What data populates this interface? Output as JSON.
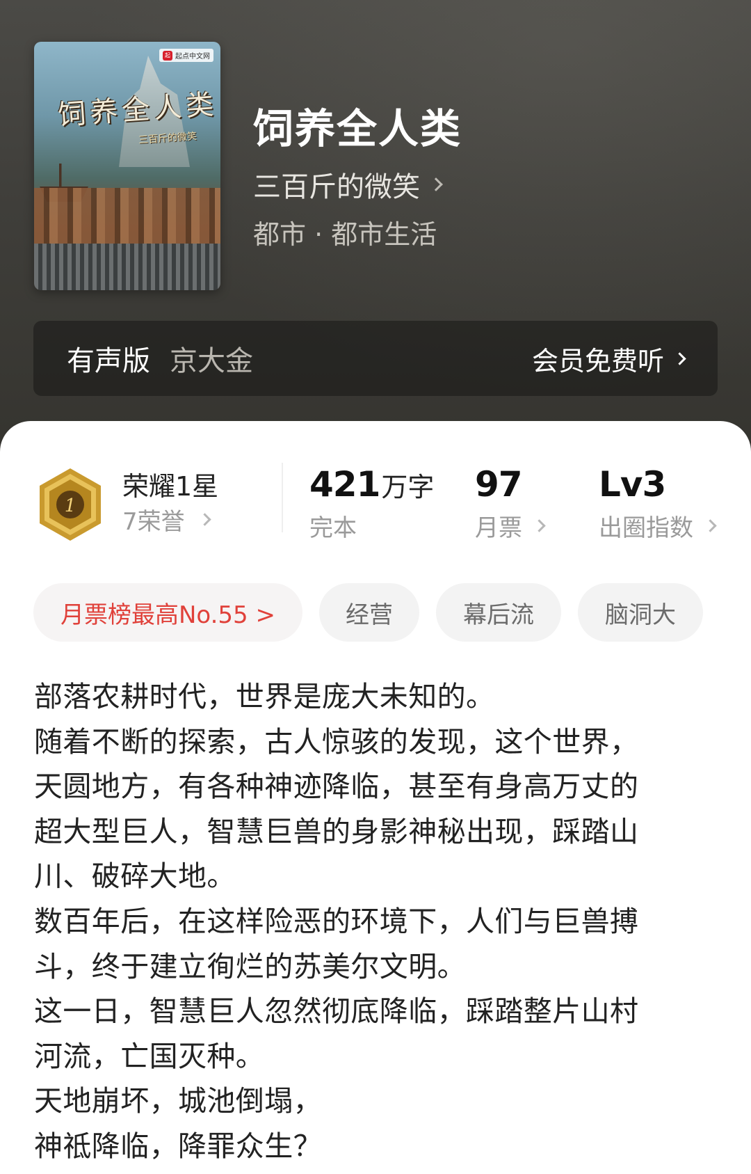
{
  "book": {
    "title": "饲养全人类",
    "author": "三百斤的微笑",
    "genre": "都市 · 都市生活"
  },
  "cover": {
    "title_art": "饲养全人类",
    "subtitle_art": "三百斤的微笑",
    "publisher_logo": "起点中文网"
  },
  "audio": {
    "label": "有声版",
    "narrator": "京大金",
    "action": "会员免费听"
  },
  "honor": {
    "title": "荣耀1星",
    "subtitle": "7荣誉",
    "badge_number": "1",
    "badge_icon": "gold-hexagon-medal-icon"
  },
  "stats": {
    "words_value": "421",
    "words_unit": "万字",
    "words_label": "完本",
    "votes_value": "97",
    "votes_label": "月票",
    "level_value": "Lv3",
    "level_label": "出圈指数"
  },
  "tags": {
    "rank": "月票榜最高No.55 >",
    "items": [
      "经营",
      "幕后流",
      "脑洞大"
    ]
  },
  "synopsis": {
    "lines": [
      "部落农耕时代，世界是庞大未知的。",
      "随着不断的探索，古人惊骇的发现，这个世界，",
      "天圆地方，有各种神迹降临，甚至有身高万丈的",
      "超大型巨人，智慧巨兽的身影神秘出现，踩踏山",
      "川、破碎大地。",
      "数百年后，在这样险恶的环境下，人们与巨兽搏",
      "斗，终于建立徇烂的苏美尔文明。",
      "这一日，智慧巨人忽然彻底降临，踩踏整片山村",
      "河流，亡国灭种。",
      "天地崩坏，城池倒塌，",
      "神祗降临，降罪众生？"
    ]
  },
  "colors": {
    "header_bg": "#3f3e3a",
    "accent_red": "#e0413a",
    "badge_gold": "#c99a2e"
  }
}
